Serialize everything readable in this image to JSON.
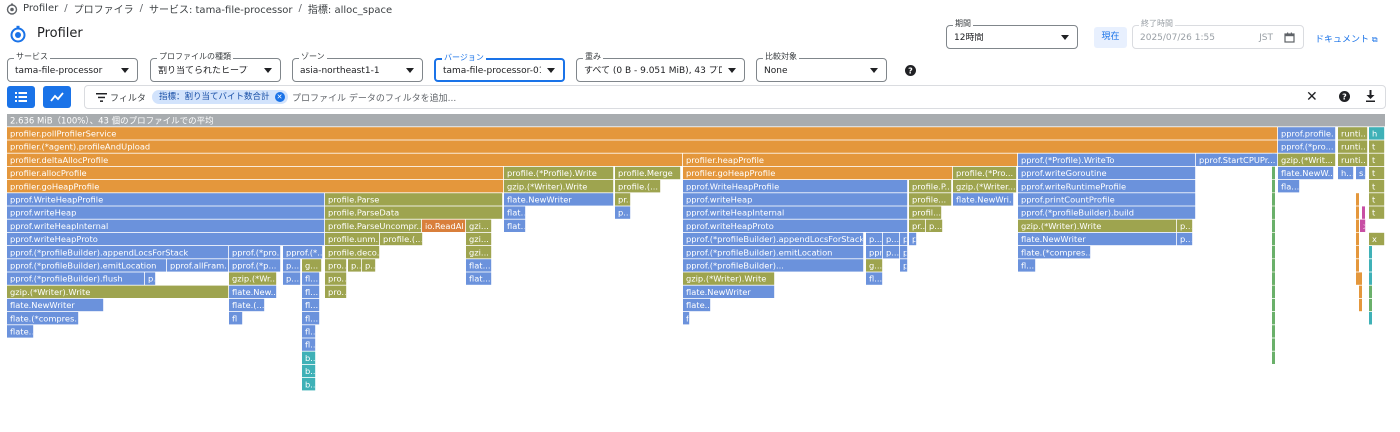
{
  "breadcrumb": [
    "Profiler",
    "プロファイラ",
    "サービス: tama-file-processor",
    "指標: alloc_space"
  ],
  "app_title": "Profiler",
  "controls": {
    "period": {
      "label": "期間",
      "value": "12時間"
    },
    "now_button": "現在",
    "end_time": {
      "label": "終了時間",
      "value": "2025/07/26 1:55",
      "tz": "JST"
    },
    "docs_link": "ドキュメント",
    "service": {
      "label": "サービス",
      "value": "tama-file-processor"
    },
    "profile_type": {
      "label": "プロファイルの種類",
      "value": "割り当てられたヒープ"
    },
    "zone": {
      "label": "ゾーン",
      "value": "asia-northeast1-1"
    },
    "version": {
      "label": "バージョン",
      "value": "tama-file-processor-0151..."
    },
    "weight": {
      "label": "重み",
      "value": "すべて (0 B - 9.051 MiB), 43 プロフ..."
    },
    "compare": {
      "label": "比較対象",
      "value": "None"
    }
  },
  "filter": {
    "label": "フィルタ",
    "chip": "指標：割り当てバイト数合計",
    "placeholder": "プロファイル データのフィルタを追加..."
  },
  "colors": {
    "orange": "#e4973c",
    "olive": "#9ea44f",
    "blue": "#6b92dc",
    "teal": "#3fb1b7",
    "gray": "#a8acaf",
    "orange_dark": "#d97f3b",
    "green": "#6ab06a",
    "magenta": "#c84fa4",
    "accent": "#1a73e8"
  },
  "flame": {
    "root": "2.636 MiB（100%）、43 個のプロファイルでの平均",
    "frames": [
      [
        "profiler.pollProfilerService",
        "orange"
      ],
      [
        "pprof.profile...",
        "blue"
      ],
      [
        "runti...",
        "olive"
      ],
      [
        "h",
        "teal"
      ],
      [
        "profiler.(*agent).profileAndUpload",
        "orange"
      ],
      [
        "pprof.(*pro...",
        "blue"
      ],
      [
        "runti...",
        "olive"
      ],
      [
        "t",
        "olive"
      ],
      [
        "profiler.deltaAllocProfile",
        "orange"
      ],
      [
        "profiler.heapProfile",
        "orange"
      ],
      [
        "pprof.(*Profile).WriteTo",
        "blue"
      ],
      [
        "pprof.StartCPUPr...",
        "blue"
      ],
      [
        "gzip.(*Writ...",
        "olive"
      ],
      [
        "runti...",
        "olive"
      ],
      [
        "t",
        "olive"
      ],
      [
        "profiler.allocProfile",
        "orange"
      ],
      [
        "profile.(*Profile).Write",
        "olive"
      ],
      [
        "profile.Merge",
        "olive"
      ],
      [
        "profiler.goHeapProfile",
        "orange"
      ],
      [
        "profile.(*Pro...",
        "olive"
      ],
      [
        "pprof.writeGoroutine",
        "blue"
      ],
      [
        "flate.NewW...",
        "blue"
      ],
      [
        "h...",
        "blue"
      ],
      [
        "s...",
        "blue"
      ],
      [
        "t",
        "olive"
      ],
      [
        "profiler.goHeapProfile",
        "orange"
      ],
      [
        "gzip.(*Writer).Write",
        "olive"
      ],
      [
        "profile.(...",
        "olive"
      ],
      [
        "pprof.WriteHeapProfile",
        "blue"
      ],
      [
        "profile.P...",
        "olive"
      ],
      [
        "gzip.(*Writer...",
        "olive"
      ],
      [
        "pprof.writeRuntimeProfile",
        "blue"
      ],
      [
        "fla...",
        "blue"
      ],
      [
        "t",
        "olive"
      ],
      [
        "pprof.WriteHeapProfile",
        "blue"
      ],
      [
        "profile.Parse",
        "olive"
      ],
      [
        "flate.NewWriter",
        "blue"
      ],
      [
        "pr...",
        "olive"
      ],
      [
        "pprof.writeHeap",
        "blue"
      ],
      [
        "profile...",
        "olive"
      ],
      [
        "flate.NewWri...",
        "blue"
      ],
      [
        "pprof.printCountProfile",
        "blue"
      ],
      [
        "t",
        "olive"
      ],
      [
        "pprof.writeHeap",
        "blue"
      ],
      [
        "profile.ParseData",
        "olive"
      ],
      [
        "flat...",
        "blue"
      ],
      [
        "p...",
        "blue"
      ],
      [
        "pprof.writeHeapInternal",
        "blue"
      ],
      [
        "profil...",
        "olive"
      ],
      [
        "pprof.(*profileBuilder).build",
        "blue"
      ],
      [
        "t",
        "olive"
      ],
      [
        "pprof.writeHeapInternal",
        "blue"
      ],
      [
        "profile.ParseUncompr...",
        "olive"
      ],
      [
        "io.ReadAll",
        "orange_dark"
      ],
      [
        "gzi...",
        "olive"
      ],
      [
        "flat...",
        "blue"
      ],
      [
        "pprof.writeHeapProto",
        "blue"
      ],
      [
        "pr...",
        "olive"
      ],
      [
        "p...",
        "olive"
      ],
      [
        "gzip.(*Writer).Write",
        "olive"
      ],
      [
        "p...",
        "olive"
      ],
      [
        "x",
        "magenta"
      ],
      [
        "pprof.writeHeapProto",
        "blue"
      ],
      [
        "profile.unm...",
        "olive"
      ],
      [
        "profile.(...",
        "olive"
      ],
      [
        "gzi...",
        "olive"
      ],
      [
        "pprof.(*profileBuilder).appendLocsForStack",
        "blue"
      ],
      [
        "p...",
        "blue"
      ],
      [
        "p...",
        "blue"
      ],
      [
        "p...",
        "blue"
      ],
      [
        "p...",
        "blue"
      ],
      [
        "flate.NewWriter",
        "blue"
      ],
      [
        "p...",
        "blue"
      ],
      [
        "x",
        "olive"
      ],
      [
        "pprof.(*profileBuilder).appendLocsForStack",
        "blue"
      ],
      [
        "pprof.(*pro...",
        "blue"
      ],
      [
        "pprof.(*...",
        "blue"
      ],
      [
        "profile.deco...",
        "olive"
      ],
      [
        "gzi...",
        "olive"
      ],
      [
        "pprof.(*profileBuilder).emitLocation",
        "blue"
      ],
      [
        "pprof...",
        "blue"
      ],
      [
        "p...",
        "blue"
      ],
      [
        "p...",
        "blue"
      ],
      [
        "flate.(*compres...",
        "blue"
      ],
      [
        "pprof.(*profileBuilder).emitLocation",
        "blue"
      ],
      [
        "pprof.allFram...",
        "blue"
      ],
      [
        "pprof.(*p...",
        "blue"
      ],
      [
        "p...",
        "blue"
      ],
      [
        "g...",
        "olive"
      ],
      [
        "pro...",
        "olive"
      ],
      [
        "p...",
        "olive"
      ],
      [
        "p...",
        "olive"
      ],
      [
        "flat...",
        "blue"
      ],
      [
        "pprof.(*profileBuilder)...",
        "blue"
      ],
      [
        "g...",
        "olive"
      ],
      [
        "p...",
        "blue"
      ],
      [
        "fl...",
        "blue"
      ],
      [
        "pprof.(*profileBuilder).flush",
        "blue"
      ],
      [
        "p...",
        "blue"
      ],
      [
        "gzip.(*Wr...",
        "olive"
      ],
      [
        "p...",
        "blue"
      ],
      [
        "fl...",
        "blue"
      ],
      [
        "pro...",
        "olive"
      ],
      [
        "flat...",
        "blue"
      ],
      [
        "gzip.(*Writer).Write",
        "olive"
      ],
      [
        "fl...",
        "blue"
      ],
      [
        "gzip.(*Writer).Write",
        "olive"
      ],
      [
        "flate.New...",
        "blue"
      ],
      [
        "fl...",
        "blue"
      ],
      [
        "pro...",
        "olive"
      ],
      [
        "flate.NewWriter",
        "blue"
      ],
      [
        "flate.NewWriter",
        "blue"
      ],
      [
        "flate.(...",
        "blue"
      ],
      [
        "fl...",
        "blue"
      ],
      [
        "flate...",
        "blue"
      ],
      [
        "flate.(*compres...",
        "blue"
      ],
      [
        "fl",
        "blue"
      ],
      [
        "fl...",
        "blue"
      ],
      [
        "f...",
        "blue"
      ],
      [
        "flate...",
        "blue"
      ],
      [
        "fl...",
        "blue"
      ],
      [
        "fl...",
        "blue"
      ],
      [
        "b...",
        "teal"
      ],
      [
        "b...",
        "teal"
      ],
      [
        "b...",
        "teal"
      ]
    ]
  }
}
